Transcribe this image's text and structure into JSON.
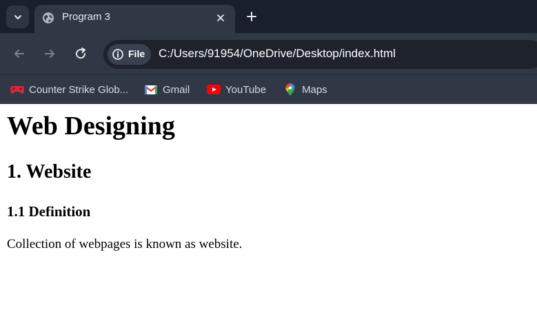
{
  "browser": {
    "tab": {
      "title": "Program 3"
    },
    "address_bar": {
      "scheme_chip": "File",
      "url": "C:/Users/91954/OneDrive/Desktop/index.html"
    },
    "bookmarks": [
      {
        "label": "Counter Strike Glob...",
        "icon": "gamepad-icon"
      },
      {
        "label": "Gmail",
        "icon": "gmail-icon"
      },
      {
        "label": "YouTube",
        "icon": "youtube-icon"
      },
      {
        "label": "Maps",
        "icon": "maps-icon"
      }
    ]
  },
  "page": {
    "h1": "Web Designing",
    "h2": "1. Website",
    "h3": "1.1 Definition",
    "paragraph": "Collection of webpages is known as website."
  },
  "colors": {
    "tabstrip": "#1a1f2c",
    "toolbar": "#303846",
    "omnibox": "#1d222d",
    "page_background": "#ffffff"
  }
}
